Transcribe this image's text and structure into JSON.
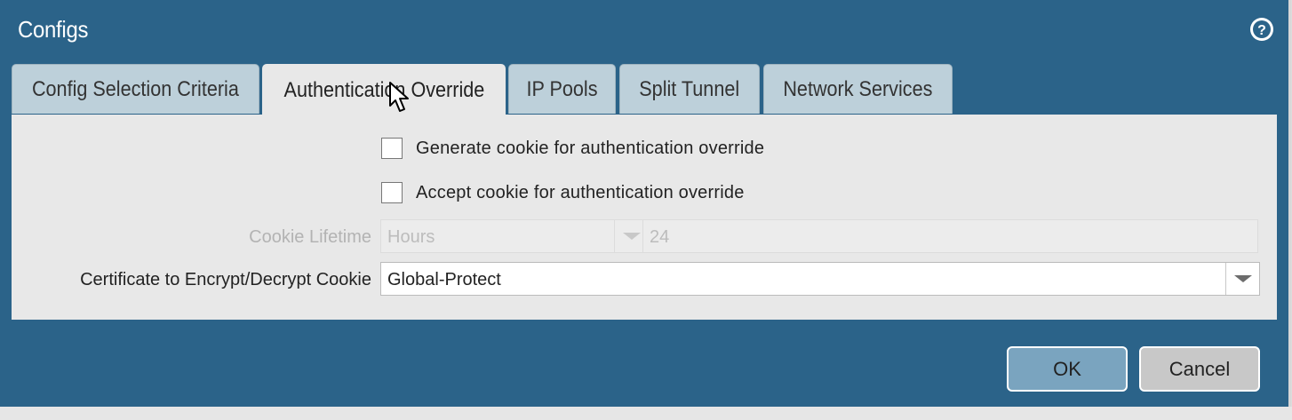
{
  "dialog": {
    "title": "Configs",
    "help_icon": "question-circle-icon"
  },
  "tabs": [
    {
      "label": "Config Selection Criteria",
      "active": false
    },
    {
      "label": "Authentication Override",
      "active": true
    },
    {
      "label": "IP Pools",
      "active": false
    },
    {
      "label": "Split Tunnel",
      "active": false
    },
    {
      "label": "Network Services",
      "active": false
    }
  ],
  "auth_override": {
    "generate_cookie": {
      "label": "Generate cookie for authentication override",
      "checked": false
    },
    "accept_cookie": {
      "label": "Accept cookie for authentication override",
      "checked": false
    },
    "cookie_lifetime": {
      "label": "Cookie Lifetime",
      "unit": "Hours",
      "value": "24",
      "disabled": true
    },
    "certificate": {
      "label": "Certificate to Encrypt/Decrypt Cookie",
      "value": "Global-Protect"
    }
  },
  "buttons": {
    "ok": "OK",
    "cancel": "Cancel"
  },
  "colors": {
    "dialog_bg": "#2b6389",
    "tab_inactive": "#bdd0da",
    "panel_bg": "#e8e8e8",
    "ok_button": "#7aa4bf",
    "cancel_button": "#c8c8c8"
  }
}
